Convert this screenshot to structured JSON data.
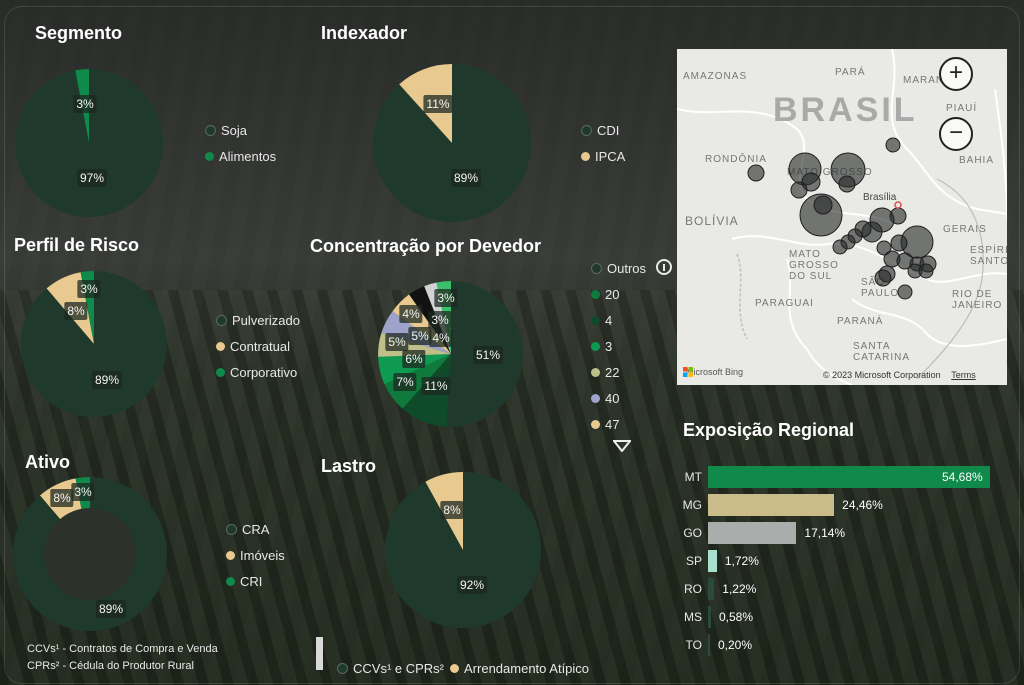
{
  "segmento": {
    "title": "Segmento",
    "legend": [
      {
        "label": "Soja",
        "color": "#1f3a2c"
      },
      {
        "label": "Alimentos",
        "color": "#0f8a4a"
      }
    ],
    "pct_labels": [
      "3%",
      "97%"
    ]
  },
  "indexador": {
    "title": "Indexador",
    "legend": [
      {
        "label": "CDI",
        "color": "#1f3a2c"
      },
      {
        "label": "IPCA",
        "color": "#e8c98f"
      }
    ],
    "pct_labels": [
      "11%",
      "89%"
    ]
  },
  "perfil": {
    "title": "Perfil de Risco",
    "legend": [
      {
        "label": "Pulverizado",
        "color": "#1f3a2c"
      },
      {
        "label": "Contratual",
        "color": "#e8c98f"
      },
      {
        "label": "Corporativo",
        "color": "#0f8a4a"
      }
    ],
    "pct_labels": [
      "3%",
      "8%",
      "89%"
    ]
  },
  "concentracao": {
    "title": "Concentração por Devedor",
    "legend": [
      {
        "label": "Outros",
        "color": "#1f3a2c"
      },
      {
        "label": "20",
        "color": "#0f7a3e"
      },
      {
        "label": "4",
        "color": "#0f4a2a"
      },
      {
        "label": "3",
        "color": "#0e9a50"
      },
      {
        "label": "22",
        "color": "#bfbf8a"
      },
      {
        "label": "40",
        "color": "#9ea3c9"
      },
      {
        "label": "47",
        "color": "#e8c98f"
      }
    ],
    "pct_labels": [
      "51%",
      "11%",
      "7%",
      "6%",
      "5%",
      "5%",
      "4%",
      "3%",
      "4%",
      "3%"
    ]
  },
  "ativo": {
    "title": "Ativo",
    "legend": [
      {
        "label": "CRA",
        "color": "#1f3a2c"
      },
      {
        "label": "Imóveis",
        "color": "#e8c98f"
      },
      {
        "label": "CRI",
        "color": "#0f8a4a"
      }
    ],
    "pct_labels": [
      "3%",
      "8%",
      "89%"
    ]
  },
  "lastro": {
    "title": "Lastro",
    "legend": [
      {
        "label": "CCVs¹ e CPRs²",
        "color": "#1f3a2c"
      },
      {
        "label": "Arrendamento Atípico",
        "color": "#e8c98f"
      }
    ],
    "pct_labels": [
      "8%",
      "92%"
    ]
  },
  "map": {
    "labels": [
      "AMAZONAS",
      "PARÁ",
      "MARAN",
      "PIAUÍ",
      "BAHIA",
      "RONDÔNIA",
      "BOLÍVIA",
      "MATO GROSSO",
      "Brasília",
      "GERAIS",
      "ESPÍRITO SANTO",
      "MATO GROSSO DO SUL",
      "PARAGUAI",
      "SÃO PAULO",
      "RIO DE JANEIRO",
      "PARANÁ",
      "SANTA CATARINA"
    ],
    "big_label": "BRASIL",
    "zoom_in": "+",
    "zoom_out": "−",
    "bing": "Microsoft Bing",
    "copyright": "© 2023 Microsoft Corporation",
    "terms": "Terms"
  },
  "regional": {
    "title": "Exposição Regional",
    "bars": [
      {
        "label": "MT",
        "value": 54.68,
        "text": "54,68%",
        "color": "#0f8a4a"
      },
      {
        "label": "MG",
        "value": 24.46,
        "text": "24,46%",
        "color": "#c9bc8a"
      },
      {
        "label": "GO",
        "value": 17.14,
        "text": "17,14%",
        "color": "#a9adab"
      },
      {
        "label": "SP",
        "value": 1.72,
        "text": "1,72%",
        "color": "#a8e0d0"
      },
      {
        "label": "RO",
        "value": 1.22,
        "text": "1,22%",
        "color": "#2b4a3a"
      },
      {
        "label": "MS",
        "value": 0.58,
        "text": "0,58%",
        "color": "#2b4a3a"
      },
      {
        "label": "TO",
        "value": 0.2,
        "text": "0,20%",
        "color": "#2b4a3a"
      }
    ]
  },
  "footnotes": [
    "CCVs¹ - Contratos de Compra e Venda",
    "CPRs² - Cédula do Produtor Rural"
  ]
}
